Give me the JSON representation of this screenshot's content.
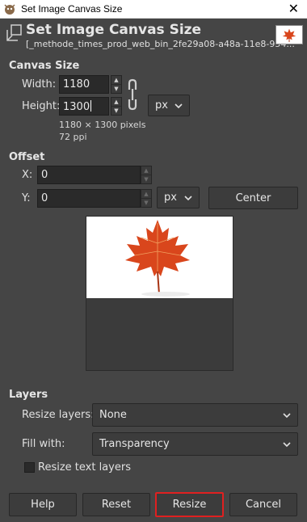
{
  "window": {
    "title": "Set Image Canvas Size",
    "close_label": "✕"
  },
  "header": {
    "title": "Set Image Canvas Size",
    "subtitle": "[_methode_times_prod_web_bin_2fe29a08-a48a-11e8-954..."
  },
  "canvas_size": {
    "section_label": "Canvas Size",
    "width_label": "Width:",
    "width_value": "1180",
    "height_label": "Height:",
    "height_value": "1300",
    "unit": "px",
    "pixels_info": "1180 × 1300 pixels",
    "ppi_info": "72 ppi"
  },
  "offset": {
    "section_label": "Offset",
    "x_label": "X:",
    "x_value": "0",
    "y_label": "Y:",
    "y_value": "0",
    "unit": "px",
    "center_label": "Center"
  },
  "layers": {
    "section_label": "Layers",
    "resize_layers_label": "Resize layers:",
    "resize_layers_value": "None",
    "fill_with_label": "Fill with:",
    "fill_with_value": "Transparency",
    "resize_text_layers_label": "Resize text layers",
    "resize_text_layers_checked": false
  },
  "buttons": {
    "help": "Help",
    "reset": "Reset",
    "resize": "Resize",
    "cancel": "Cancel"
  },
  "colors": {
    "dialog_bg": "#454545",
    "highlight": "#e02020",
    "leaf": "#d9461c"
  }
}
